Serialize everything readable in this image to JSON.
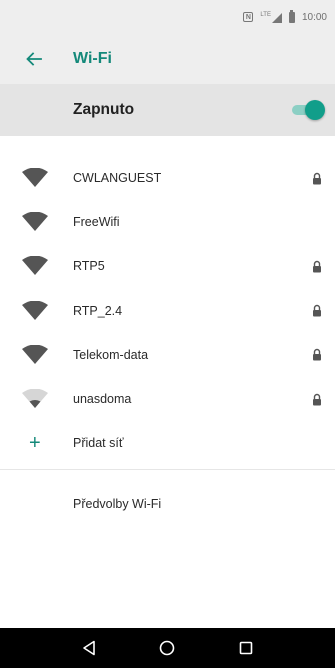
{
  "status_bar": {
    "nfc_icon": "nfc-icon",
    "network_label": "LTE",
    "signal_icon": "signal-icon",
    "battery_icon": "battery-icon",
    "time": "10:00"
  },
  "app_bar": {
    "back_icon": "arrow-left-icon",
    "title": "Wi-Fi"
  },
  "master_switch": {
    "label": "Zapnuto",
    "state": true
  },
  "networks": [
    {
      "name": "CWLANGUEST",
      "secured": true,
      "signal": "full"
    },
    {
      "name": "FreeWifi",
      "secured": false,
      "signal": "full"
    },
    {
      "name": "RTP5",
      "secured": true,
      "signal": "full"
    },
    {
      "name": "RTP_2.4",
      "secured": true,
      "signal": "full"
    },
    {
      "name": "Telekom-data",
      "secured": true,
      "signal": "full"
    },
    {
      "name": "unasdoma",
      "secured": true,
      "signal": "weak"
    }
  ],
  "add_network": {
    "icon": "plus-icon",
    "label": "Přidat síť"
  },
  "preferences": {
    "label": "Předvolby Wi-Fi"
  },
  "nav_bar": {
    "back_icon": "nav-back-icon",
    "home_icon": "nav-home-icon",
    "recents_icon": "nav-recents-icon"
  },
  "colors": {
    "accent": "#14897a",
    "switch_thumb": "#119e8a",
    "switch_track": "#8ccfc4",
    "app_bar_bg": "#eeeeee",
    "master_bg": "#e4e4e4",
    "wifi_full": "#555555",
    "wifi_weak": "#cccccc"
  }
}
